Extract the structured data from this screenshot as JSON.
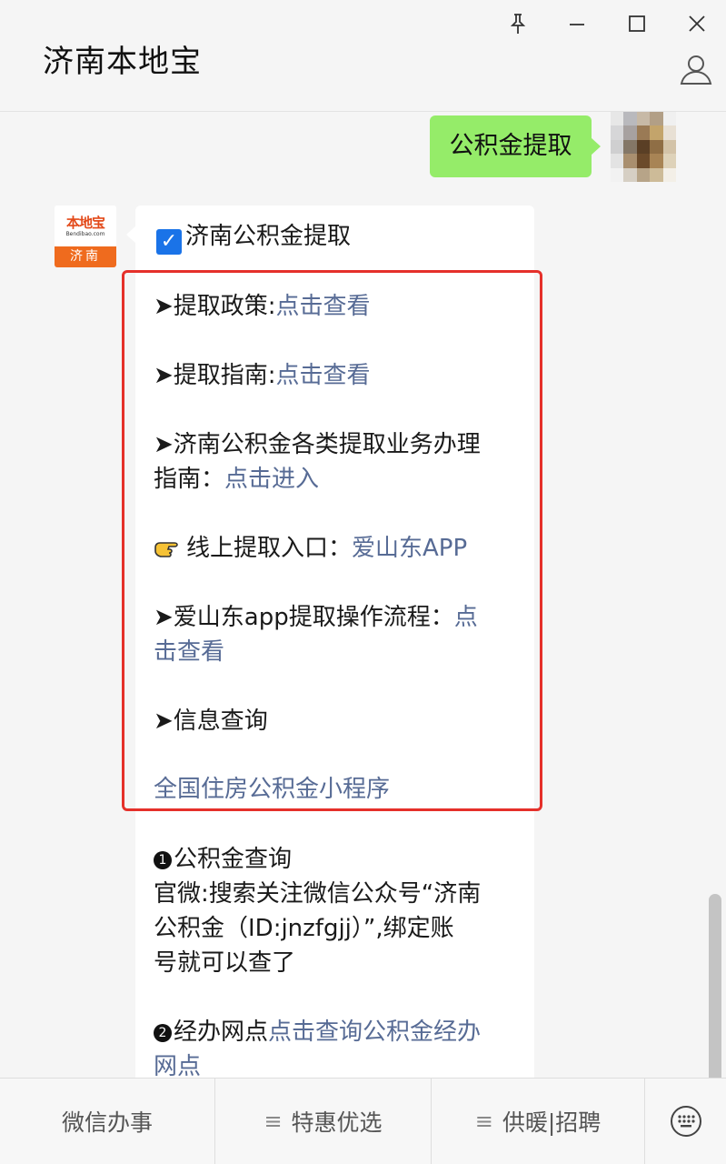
{
  "window": {
    "title": "济南本地宝",
    "pin_icon": "pin-icon",
    "minimize_icon": "minimize-icon",
    "maximize_icon": "maximize-icon",
    "close_icon": "close-icon",
    "profile_icon": "person-icon"
  },
  "outgoing": {
    "text": "公积金提取"
  },
  "bot_avatar": {
    "logo": "本地宝",
    "domain": "Bendibao.com",
    "city": "济南"
  },
  "message": {
    "heading": "济南公积金提取",
    "items": [
      {
        "prefix": "➤提取政策:",
        "link": "点击查看"
      },
      {
        "prefix": "➤提取指南:",
        "link": "点击查看"
      },
      {
        "prefix": "➤济南公积金各类提取业务办理",
        "prefix2": "指南：",
        "link": "点击进入"
      },
      {
        "prefix": "线上提取入口：",
        "link": "爱山东APP"
      },
      {
        "prefix": "➤爱山东app提取操作流程：",
        "link": "点",
        "link2": "击查看"
      },
      {
        "prefix": "➤信息查询"
      },
      {
        "link": "全国住房公积金小程序"
      }
    ],
    "query": {
      "title": "公积金查询",
      "line1": "官微:搜索关注微信公众号“济南",
      "line2": "公积金（ID:jnzfgjj）”,绑定账",
      "line3": "号就可以查了"
    },
    "office": {
      "prefix": "经办网点",
      "link": "点击查询公积金经办",
      "link2": "网点"
    }
  },
  "menu": {
    "item1": "微信办事",
    "item2": "特惠优选",
    "item3": "供暖|招聘",
    "keyboard_icon": "keyboard-icon"
  },
  "colors": {
    "link": "#576b95",
    "bubble_out": "#95ec69",
    "highlight_box": "#e5302a"
  }
}
